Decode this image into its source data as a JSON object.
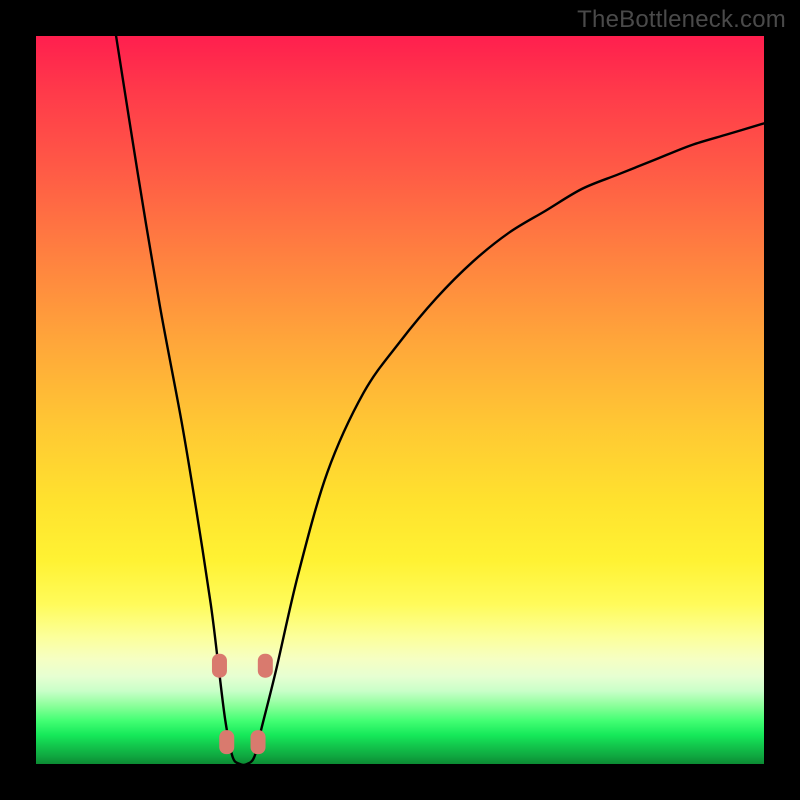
{
  "watermark": "TheBottleneck.com",
  "accent": {
    "marker_fill": "#d97a6e",
    "curve_stroke": "#000000"
  },
  "chart_data": {
    "type": "line",
    "title": "",
    "xlabel": "",
    "ylabel": "",
    "xlim": [
      0,
      100
    ],
    "ylim": [
      0,
      100
    ],
    "grid": false,
    "legend": false,
    "series": [
      {
        "name": "bottleneck-curve",
        "x": [
          11,
          14,
          17,
          20,
          22,
          24,
          25,
          26,
          27,
          28,
          29,
          30,
          31,
          33,
          36,
          40,
          45,
          50,
          55,
          60,
          65,
          70,
          75,
          80,
          85,
          90,
          95,
          100
        ],
        "values": [
          100,
          81,
          63,
          47,
          35,
          22,
          14,
          6,
          1,
          0,
          0,
          1,
          5,
          13,
          26,
          40,
          51,
          58,
          64,
          69,
          73,
          76,
          79,
          81,
          83,
          85,
          86.5,
          88
        ]
      }
    ],
    "markers": [
      {
        "x": 25.2,
        "y": 13.5
      },
      {
        "x": 31.5,
        "y": 13.5
      },
      {
        "x": 26.2,
        "y": 3.0
      },
      {
        "x": 30.5,
        "y": 3.0
      }
    ]
  }
}
